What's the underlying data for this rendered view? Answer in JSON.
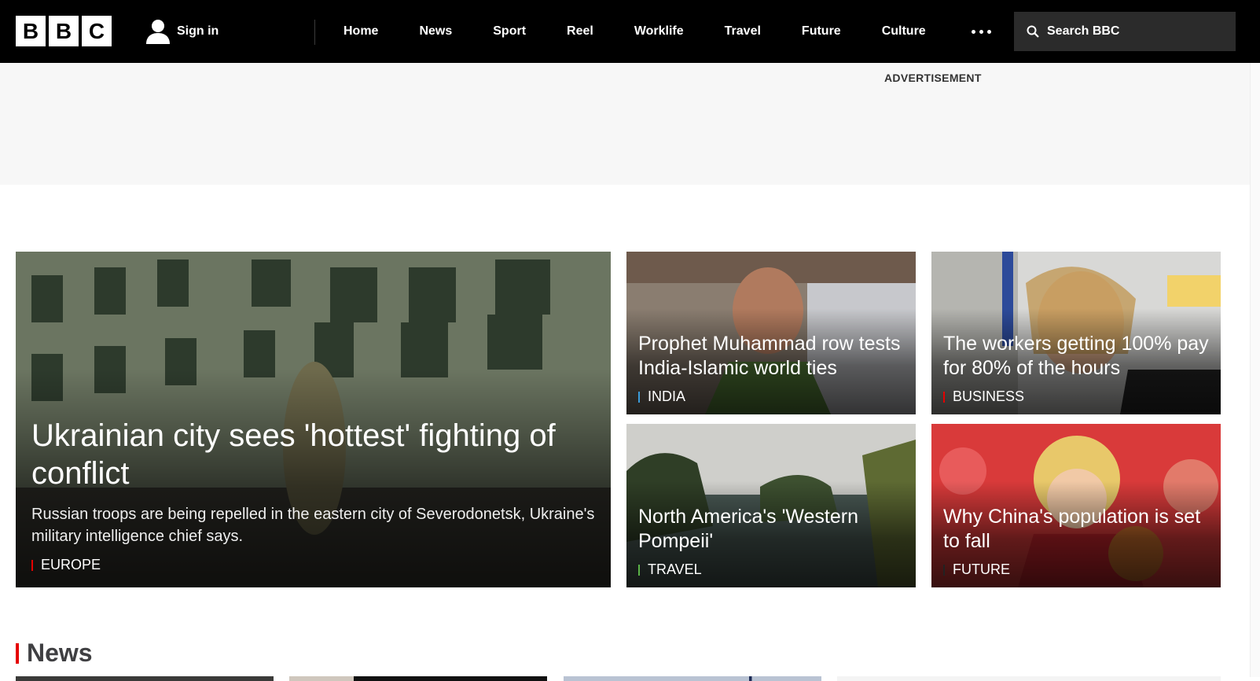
{
  "header": {
    "logo_letters": [
      "B",
      "B",
      "C"
    ],
    "signin_label": "Sign in",
    "nav": [
      "Home",
      "News",
      "Sport",
      "Reel",
      "Worklife",
      "Travel",
      "Future",
      "Culture"
    ],
    "search_placeholder": "Search BBC"
  },
  "ad": {
    "label": "ADVERTISEMENT"
  },
  "stories": {
    "lead": {
      "headline": "Ukrainian city sees 'hottest' fighting of conflict",
      "summary": "Russian troops are being repelled in the eastern city of Severodonetsk, Ukraine's military intelligence chief says.",
      "tag": "EUROPE",
      "tag_color": "#e50000"
    },
    "s1": {
      "headline": "Prophet Muhammad row tests India-Islamic world ties",
      "tag": "INDIA",
      "tag_color": "#3a9bd9"
    },
    "s2": {
      "headline": "The workers getting 100% pay for 80% of the hours",
      "tag": "BUSINESS",
      "tag_color": "#e50000"
    },
    "s3": {
      "headline": "North America's 'Western Pompeii'",
      "tag": "TRAVEL",
      "tag_color": "#5bb348"
    },
    "s4": {
      "headline": "Why China's population is set to fall",
      "tag": "FUTURE",
      "tag_color": "#222222"
    }
  },
  "sections": {
    "news_title": "News"
  }
}
